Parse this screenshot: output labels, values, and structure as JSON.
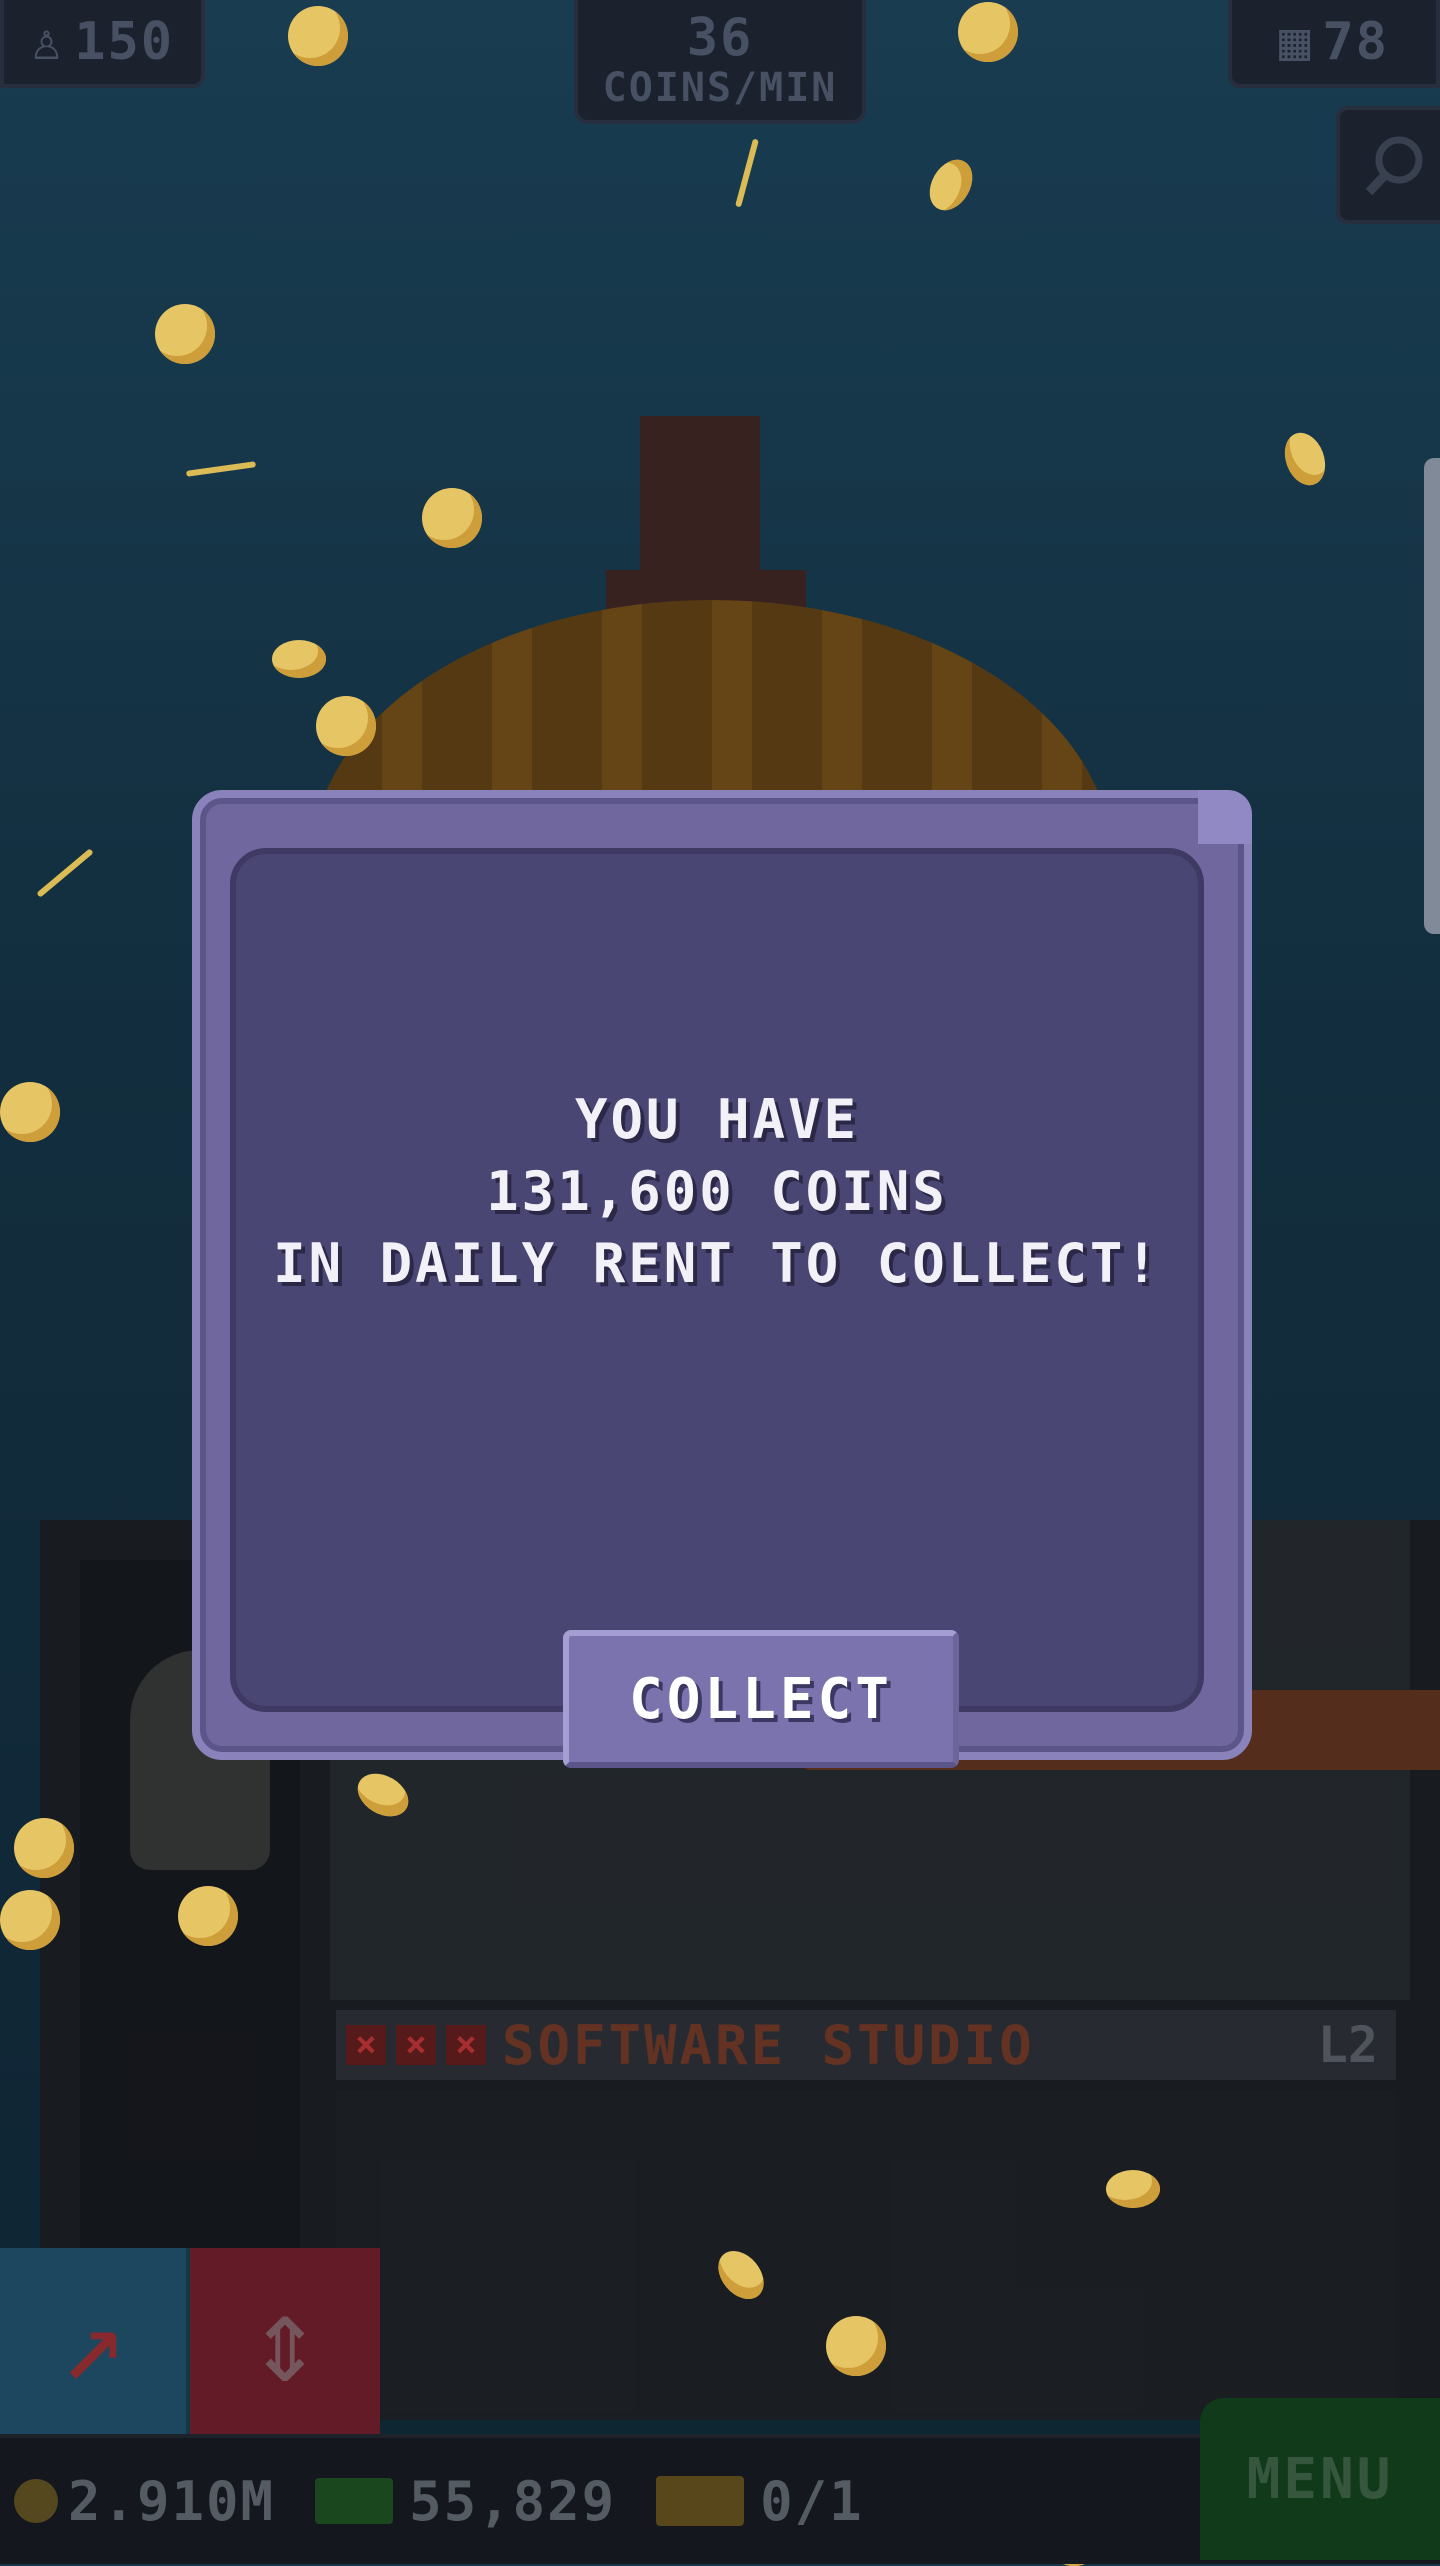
{
  "hud": {
    "population": "150",
    "coins_rate_value": "36",
    "coins_rate_unit": "COINS/MIN",
    "floors": "78"
  },
  "tower": {
    "floor_name": "SOFTWARE STUDIO",
    "floor_level": "L2"
  },
  "bottom_bar": {
    "coins": "2.910M",
    "bux": "55,829",
    "vip": "0/1",
    "menu_label": "MENU"
  },
  "dialog": {
    "line1": "YOU HAVE",
    "line2": "131,600 COINS",
    "line3": "IN DAILY RENT TO COLLECT!",
    "collect_label": "COLLECT"
  },
  "colors": {
    "dialog_border": "#6f679e",
    "dialog_fill": "#4a4674",
    "button": "#7a73ad",
    "sky": "#16344a"
  }
}
